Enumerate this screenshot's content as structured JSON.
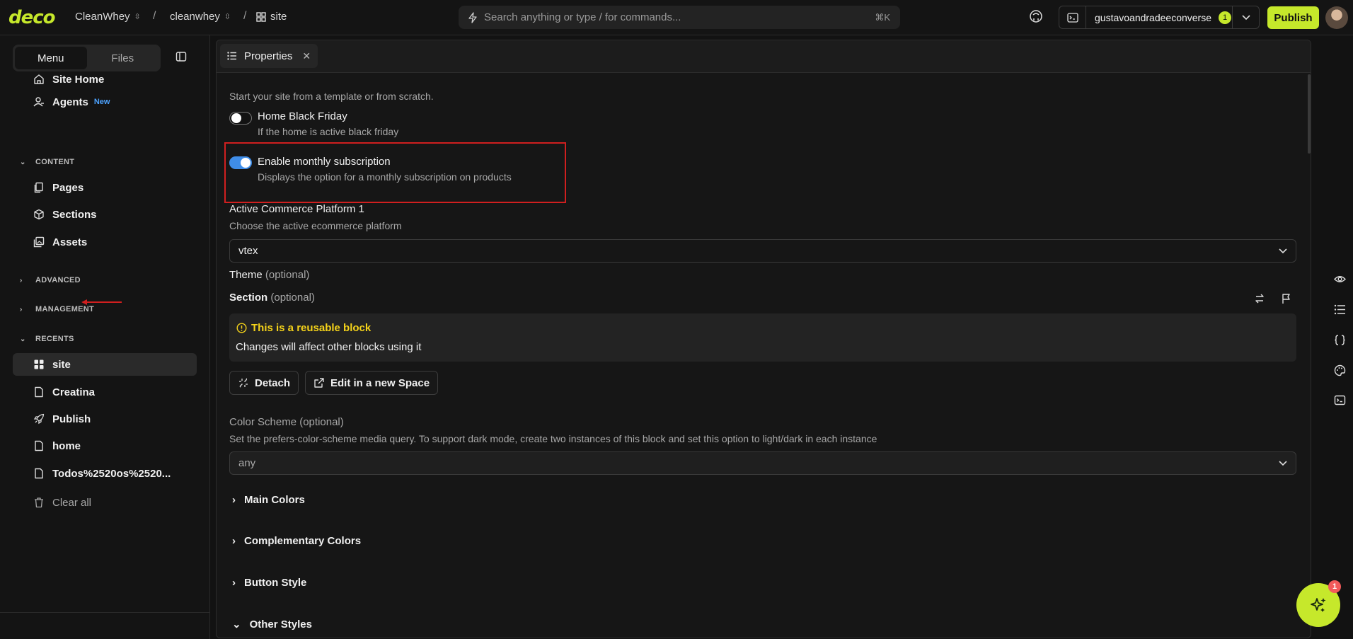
{
  "header": {
    "logo": "deco",
    "breadcrumbs": [
      "CleanWhey",
      "cleanwhey",
      "site"
    ],
    "search_placeholder": "Search anything or type / for commands...",
    "search_shortcut": "⌘K",
    "username": "gustavoandradeeconverse",
    "user_badge": "1",
    "publish_label": "Publish"
  },
  "sidebar": {
    "tabs": [
      "Menu",
      "Files"
    ],
    "active_tab": "Menu",
    "top_items": [
      {
        "label": "Site Home",
        "icon": "home-icon"
      },
      {
        "label": "Agents",
        "icon": "agents-icon",
        "tag": "New"
      }
    ],
    "sections": {
      "content": "CONTENT",
      "advanced": "ADVANCED",
      "management": "MANAGEMENT",
      "recents": "RECENTS"
    },
    "content_items": [
      {
        "label": "Pages",
        "icon": "pages-icon"
      },
      {
        "label": "Sections",
        "icon": "cube-icon"
      },
      {
        "label": "Assets",
        "icon": "image-icon"
      }
    ],
    "recent_items": [
      {
        "label": "site",
        "icon": "grid-icon",
        "selected": true
      },
      {
        "label": "Creatina",
        "icon": "file-icon"
      },
      {
        "label": "Publish",
        "icon": "rocket-icon"
      },
      {
        "label": "home",
        "icon": "file-icon"
      },
      {
        "label": "Todos%2520os%2520...",
        "icon": "file-icon"
      }
    ],
    "clear_label": "Clear all"
  },
  "panel": {
    "tab_label": "Properties",
    "intro": "Start your site from a template or from scratch.",
    "toggle1": {
      "label": "Home Black Friday",
      "desc": "If the home is active black friday",
      "on": false
    },
    "toggle2": {
      "label": "Enable monthly subscription",
      "desc": "Displays the option for a monthly subscription on products",
      "on": true
    },
    "platform": {
      "label": "Active Commerce Platform 1",
      "desc": "Choose the active ecommerce platform",
      "value": "vtex"
    },
    "theme": {
      "label": "Theme",
      "optional": "(optional)"
    },
    "section": {
      "label": "Section",
      "optional": "(optional)"
    },
    "reusable": {
      "title": "This is a reusable block",
      "message": "Changes will affect other blocks using it"
    },
    "buttons": {
      "detach": "Detach",
      "edit_space": "Edit in a new Space"
    },
    "color_scheme": {
      "label": "Color Scheme",
      "optional": "(optional)",
      "desc": "Set the prefers-color-scheme media query. To support dark mode, create two instances of this block and set this option to light/dark in each instance",
      "value": "any"
    },
    "groups": [
      "Main Colors",
      "Complementary Colors",
      "Button Style",
      "Other Styles"
    ]
  },
  "fab_badge": "1",
  "colors": {
    "accent": "#c6e82b",
    "toggle_on": "#3f8de8",
    "warning": "#f5d31a",
    "highlight": "#d01f1f"
  }
}
